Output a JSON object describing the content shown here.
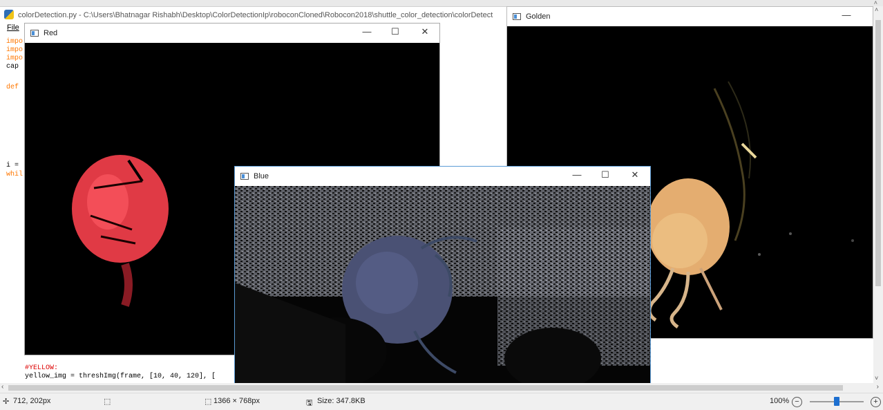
{
  "idle": {
    "title": "colorDetection.py - C:\\Users\\Bhatnagar Rishabh\\Desktop\\ColorDetectionIp\\roboconCloned\\Robocon2018\\shuttle_color_detection\\colorDetect",
    "menu_file": "File",
    "code": {
      "l1": "impo",
      "l2": "impo",
      "l3": "impo",
      "l4": "cap",
      "l5": "def",
      "l6": "i =",
      "l7": "whil",
      "comment": "#YELLOW:",
      "last": "yellow_img = threshImg(frame, [10, 40, 120], ["
    }
  },
  "windows": {
    "red": {
      "title": "Red",
      "minimize": "—",
      "maximize": "☐",
      "close": "✕"
    },
    "golden": {
      "title": "Golden",
      "minimize": "—"
    },
    "blue": {
      "title": "Blue",
      "minimize": "—",
      "maximize": "☐",
      "close": "✕"
    }
  },
  "status": {
    "cursor": "712, 202px",
    "dimensions": "1366 × 768px",
    "size": "Size: 347.8KB",
    "zoom": "100%",
    "zoom_out": "−",
    "zoom_in": "+"
  },
  "icons": {
    "cursor": "✢",
    "selection": "⬚",
    "dimensions": "⬚",
    "size": "🖫"
  },
  "scroll": {
    "left": "‹",
    "right": "›",
    "up": "˄",
    "down": "˅"
  }
}
